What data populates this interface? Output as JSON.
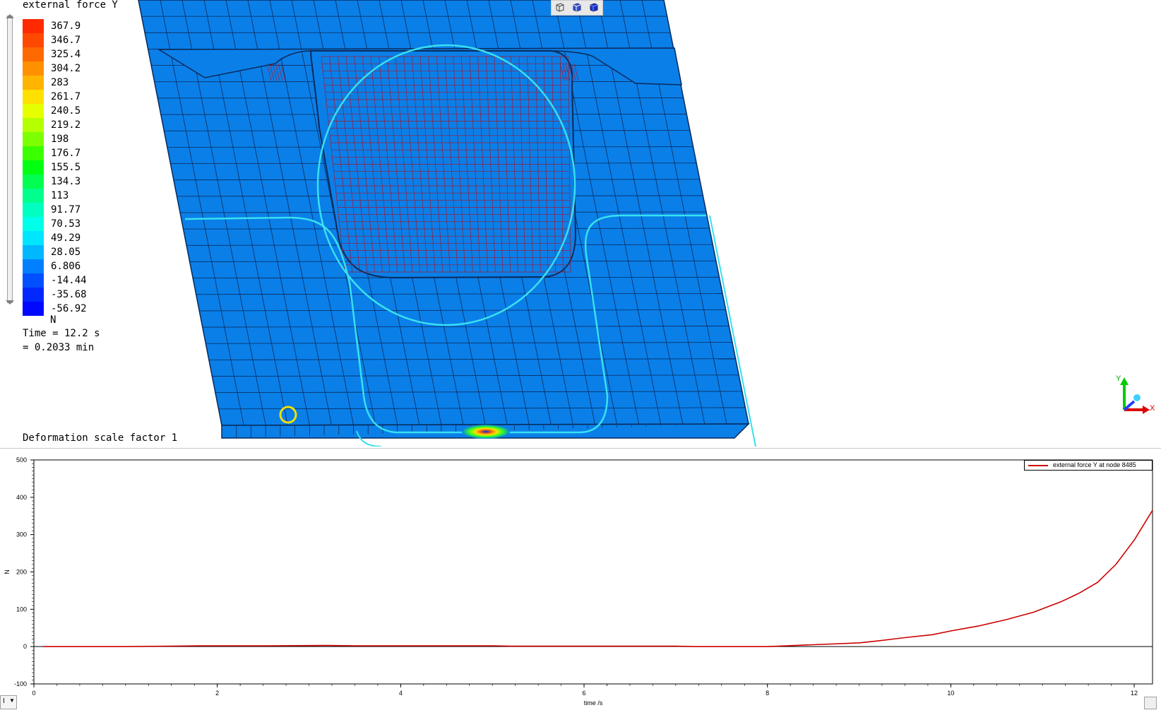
{
  "viewer": {
    "legend": {
      "title": "external force Y",
      "entries": [
        {
          "label": "367.9",
          "color": "#ff2a00"
        },
        {
          "label": "346.7",
          "color": "#ff4800"
        },
        {
          "label": "325.4",
          "color": "#ff6a00"
        },
        {
          "label": "304.2",
          "color": "#ff9000"
        },
        {
          "label": "283",
          "color": "#ffb400"
        },
        {
          "label": "261.7",
          "color": "#ffe000"
        },
        {
          "label": "240.5",
          "color": "#e6ff00"
        },
        {
          "label": "219.2",
          "color": "#b4ff00"
        },
        {
          "label": "198",
          "color": "#7cff00"
        },
        {
          "label": "176.7",
          "color": "#3cff00"
        },
        {
          "label": "155.5",
          "color": "#00ff10"
        },
        {
          "label": "134.3",
          "color": "#00ff50"
        },
        {
          "label": "113",
          "color": "#00ff8c"
        },
        {
          "label": "91.77",
          "color": "#00ffc0"
        },
        {
          "label": "70.53",
          "color": "#00ffe8"
        },
        {
          "label": "49.29",
          "color": "#00e6ff"
        },
        {
          "label": "28.05",
          "color": "#00b8ff"
        },
        {
          "label": "6.806",
          "color": "#0080ff"
        },
        {
          "label": "-14.44",
          "color": "#0050ff"
        },
        {
          "label": "-35.68",
          "color": "#0028ff"
        },
        {
          "label": "-56.92",
          "color": "#0008ff"
        }
      ],
      "unit": "N"
    },
    "time_line1": "Time = 12.2 s",
    "time_line2": "= 0.2033 min",
    "deformation_label": "Deformation scale factor 1",
    "toolbar_icons": [
      "view-wireframe-icon",
      "view-shaded-icon",
      "view-solid-icon"
    ],
    "axis_triad": {
      "x_label": "X",
      "y_label": "Y"
    },
    "colors": {
      "mesh_body": "#0a7fe8",
      "mesh_line": "#0b2a5a",
      "contact_curve": "#38e0f0",
      "fine_mesh": "#9a1b3a"
    }
  },
  "plot": {
    "legend_label": "external force Y at node 8485",
    "selector_label": "I",
    "colors": {
      "series": "#cc0000"
    }
  },
  "chart_data": {
    "type": "line",
    "title": "",
    "xlabel": "time /s",
    "ylabel": "N",
    "xlim": [
      0,
      12.2
    ],
    "ylim": [
      -100,
      500
    ],
    "x_ticks": [
      0,
      2,
      4,
      6,
      8,
      10,
      12
    ],
    "y_ticks": [
      -100,
      0,
      100,
      200,
      300,
      400,
      500
    ],
    "series": [
      {
        "name": "external force Y at node 8485",
        "x": [
          0.1,
          1.0,
          1.8,
          2.5,
          3.2,
          3.5,
          4.2,
          5.0,
          5.2,
          6.0,
          7.0,
          7.2,
          8.0,
          8.3,
          8.6,
          9.0,
          9.2,
          9.5,
          9.8,
          10.0,
          10.3,
          10.6,
          10.9,
          11.2,
          11.4,
          11.6,
          11.8,
          12.0,
          12.2
        ],
        "y": [
          0,
          0,
          2,
          2,
          3,
          2,
          2,
          2,
          1,
          1,
          1,
          0,
          0,
          3,
          6,
          10,
          15,
          24,
          32,
          42,
          55,
          72,
          92,
          120,
          143,
          172,
          220,
          285,
          365
        ]
      }
    ]
  }
}
